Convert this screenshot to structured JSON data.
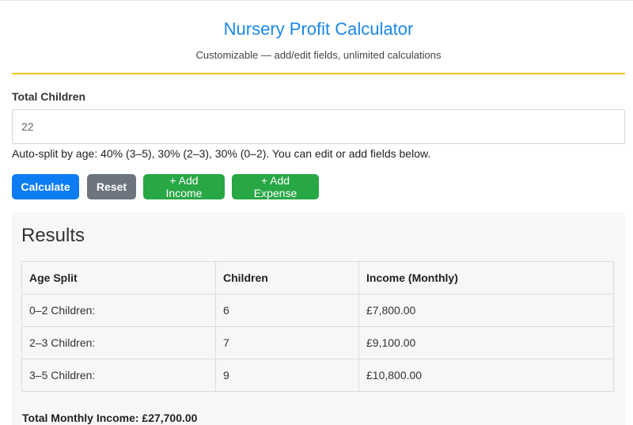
{
  "header": {
    "title": "Nursery Profit Calculator",
    "subtitle": "Customizable — add/edit fields, unlimited calculations"
  },
  "children_field": {
    "label": "Total Children",
    "value": "22"
  },
  "help_text": "Auto-split by age: 40% (3–5), 30% (2–3), 30% (0–2). You can edit or add fields below.",
  "buttons": {
    "calculate": "Calculate",
    "reset": "Reset",
    "add_income": "+ Add Income",
    "add_expense": "+ Add Expense"
  },
  "results": {
    "title": "Results",
    "columns": [
      "Age Split",
      "Children",
      "Income (Monthly)"
    ],
    "rows": [
      [
        "0–2 Children:",
        "6",
        "£7,800.00"
      ],
      [
        "2–3 Children:",
        "7",
        "£9,100.00"
      ],
      [
        "3–5 Children:",
        "9",
        "£10,800.00"
      ]
    ],
    "total": "Total Monthly Income: £27,700.00"
  },
  "colors": {
    "primary": "#0d7cf2",
    "secondary": "#6c757d",
    "success": "#28a745",
    "title": "#1a88e8",
    "accent_rule": "#f5c518"
  }
}
